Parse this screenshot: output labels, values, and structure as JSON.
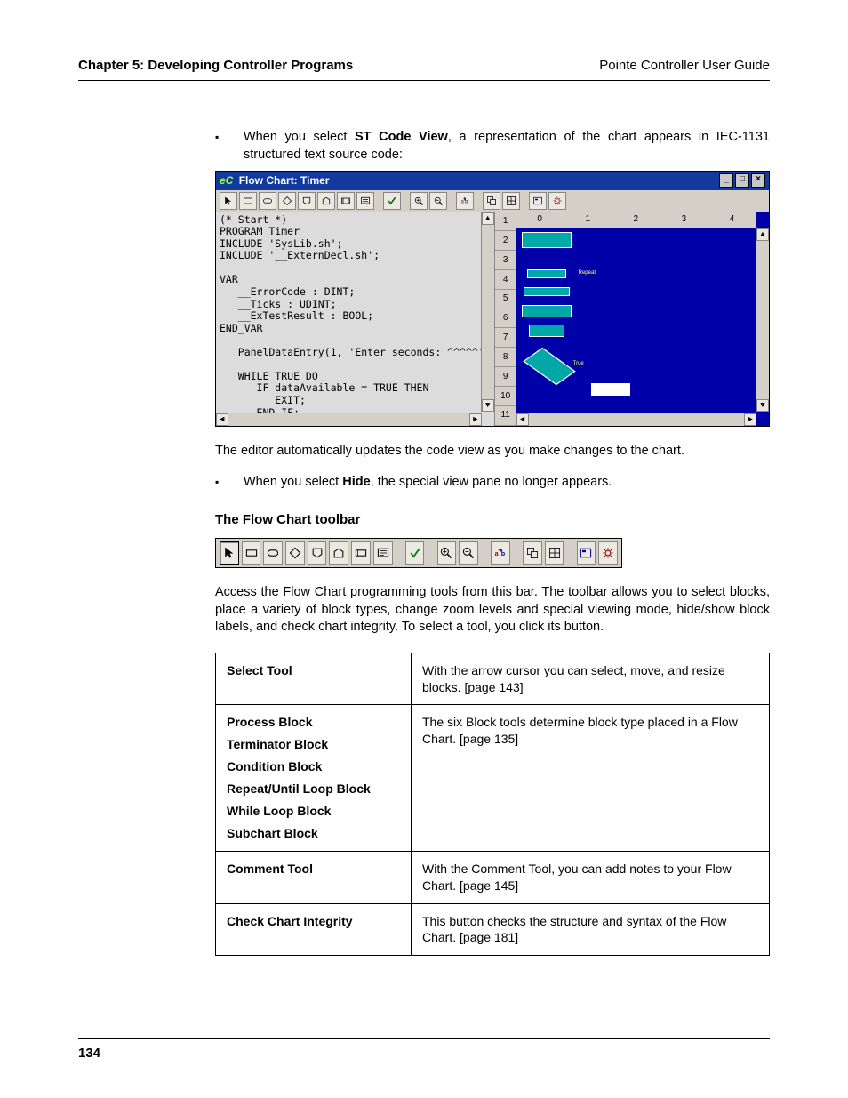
{
  "header": {
    "chapter": "Chapter 5: Developing Controller Programs",
    "guide": "Pointe Controller User Guide"
  },
  "bullets": {
    "b1_pre": "When you select ",
    "b1_bold": "ST Code View",
    "b1_post": ", a representation of the chart appears in IEC-1131 structured text source code:",
    "b2_pre": "When you select ",
    "b2_bold": "Hide",
    "b2_post": ", the special view pane no longer appears."
  },
  "embedded": {
    "title_prefix": "eC",
    "title": "Flow Chart: Timer",
    "win_min": "_",
    "win_max": "□",
    "win_close": "×",
    "cols": [
      "0",
      "1",
      "2",
      "3",
      "4"
    ],
    "rows": [
      "1",
      "2",
      "3",
      "4",
      "5",
      "6",
      "7",
      "8",
      "9",
      "10",
      "11"
    ],
    "code": "(* Start *)\nPROGRAM Timer\nINCLUDE 'SysLib.sh';\nINCLUDE '__ExternDecl.sh';\n\nVAR\n   __ErrorCode : DINT;\n   __Ticks : UDINT;\n   __ExTestResult : BOOL;\nEND_VAR\n\n   PanelDataEntry(1, 'Enter seconds: ^^^^^',\n\n   WHILE TRUE DO\n      IF dataAvailable = TRUE THEN\n         EXIT;\n      END_IF;\n      Yield();\n   END_WHILE;\n\n   dataValueInt := dataValue;\n\n   T_RESET(counter);"
  },
  "para_after": "The editor automatically updates the code view as you make changes to the chart.",
  "section_heading": "The Flow Chart toolbar",
  "toolbar_para": "Access the Flow Chart programming tools from this bar. The toolbar allows you to select blocks, place a variety of block types, change zoom levels and special viewing mode, hide/show block labels, and check chart integrity. To select a tool, you click its button.",
  "toolbar_icons": [
    "pointer-icon",
    "process-block-icon",
    "terminator-block-icon",
    "condition-block-icon",
    "repeat-loop-block-icon",
    "while-loop-block-icon",
    "subchart-block-icon",
    "comment-block-icon",
    "check-integrity-icon",
    "zoom-in-icon",
    "zoom-out-icon",
    "replace-vars-icon",
    "copy-view-icon",
    "special-view-icon",
    "labels-icon",
    "settings-icon"
  ],
  "table": {
    "r1_label": "Select Tool",
    "r1_desc": "With the arrow cursor you can select, move, and resize blocks. [page 143]",
    "r2_labels": [
      "Process Block",
      "Terminator Block",
      "Condition Block",
      "Repeat/Until Loop Block",
      "While Loop Block",
      "Subchart Block"
    ],
    "r2_desc": "The six Block tools determine block type placed in a Flow Chart. [page 135]",
    "r3_label": "Comment Tool",
    "r3_desc": "With the Comment Tool, you can add notes to your Flow Chart. [page 145]",
    "r4_label": "Check Chart Integrity",
    "r4_desc": "This button checks the structure and syntax of the Flow Chart. [page 181]"
  },
  "page_number": "134"
}
